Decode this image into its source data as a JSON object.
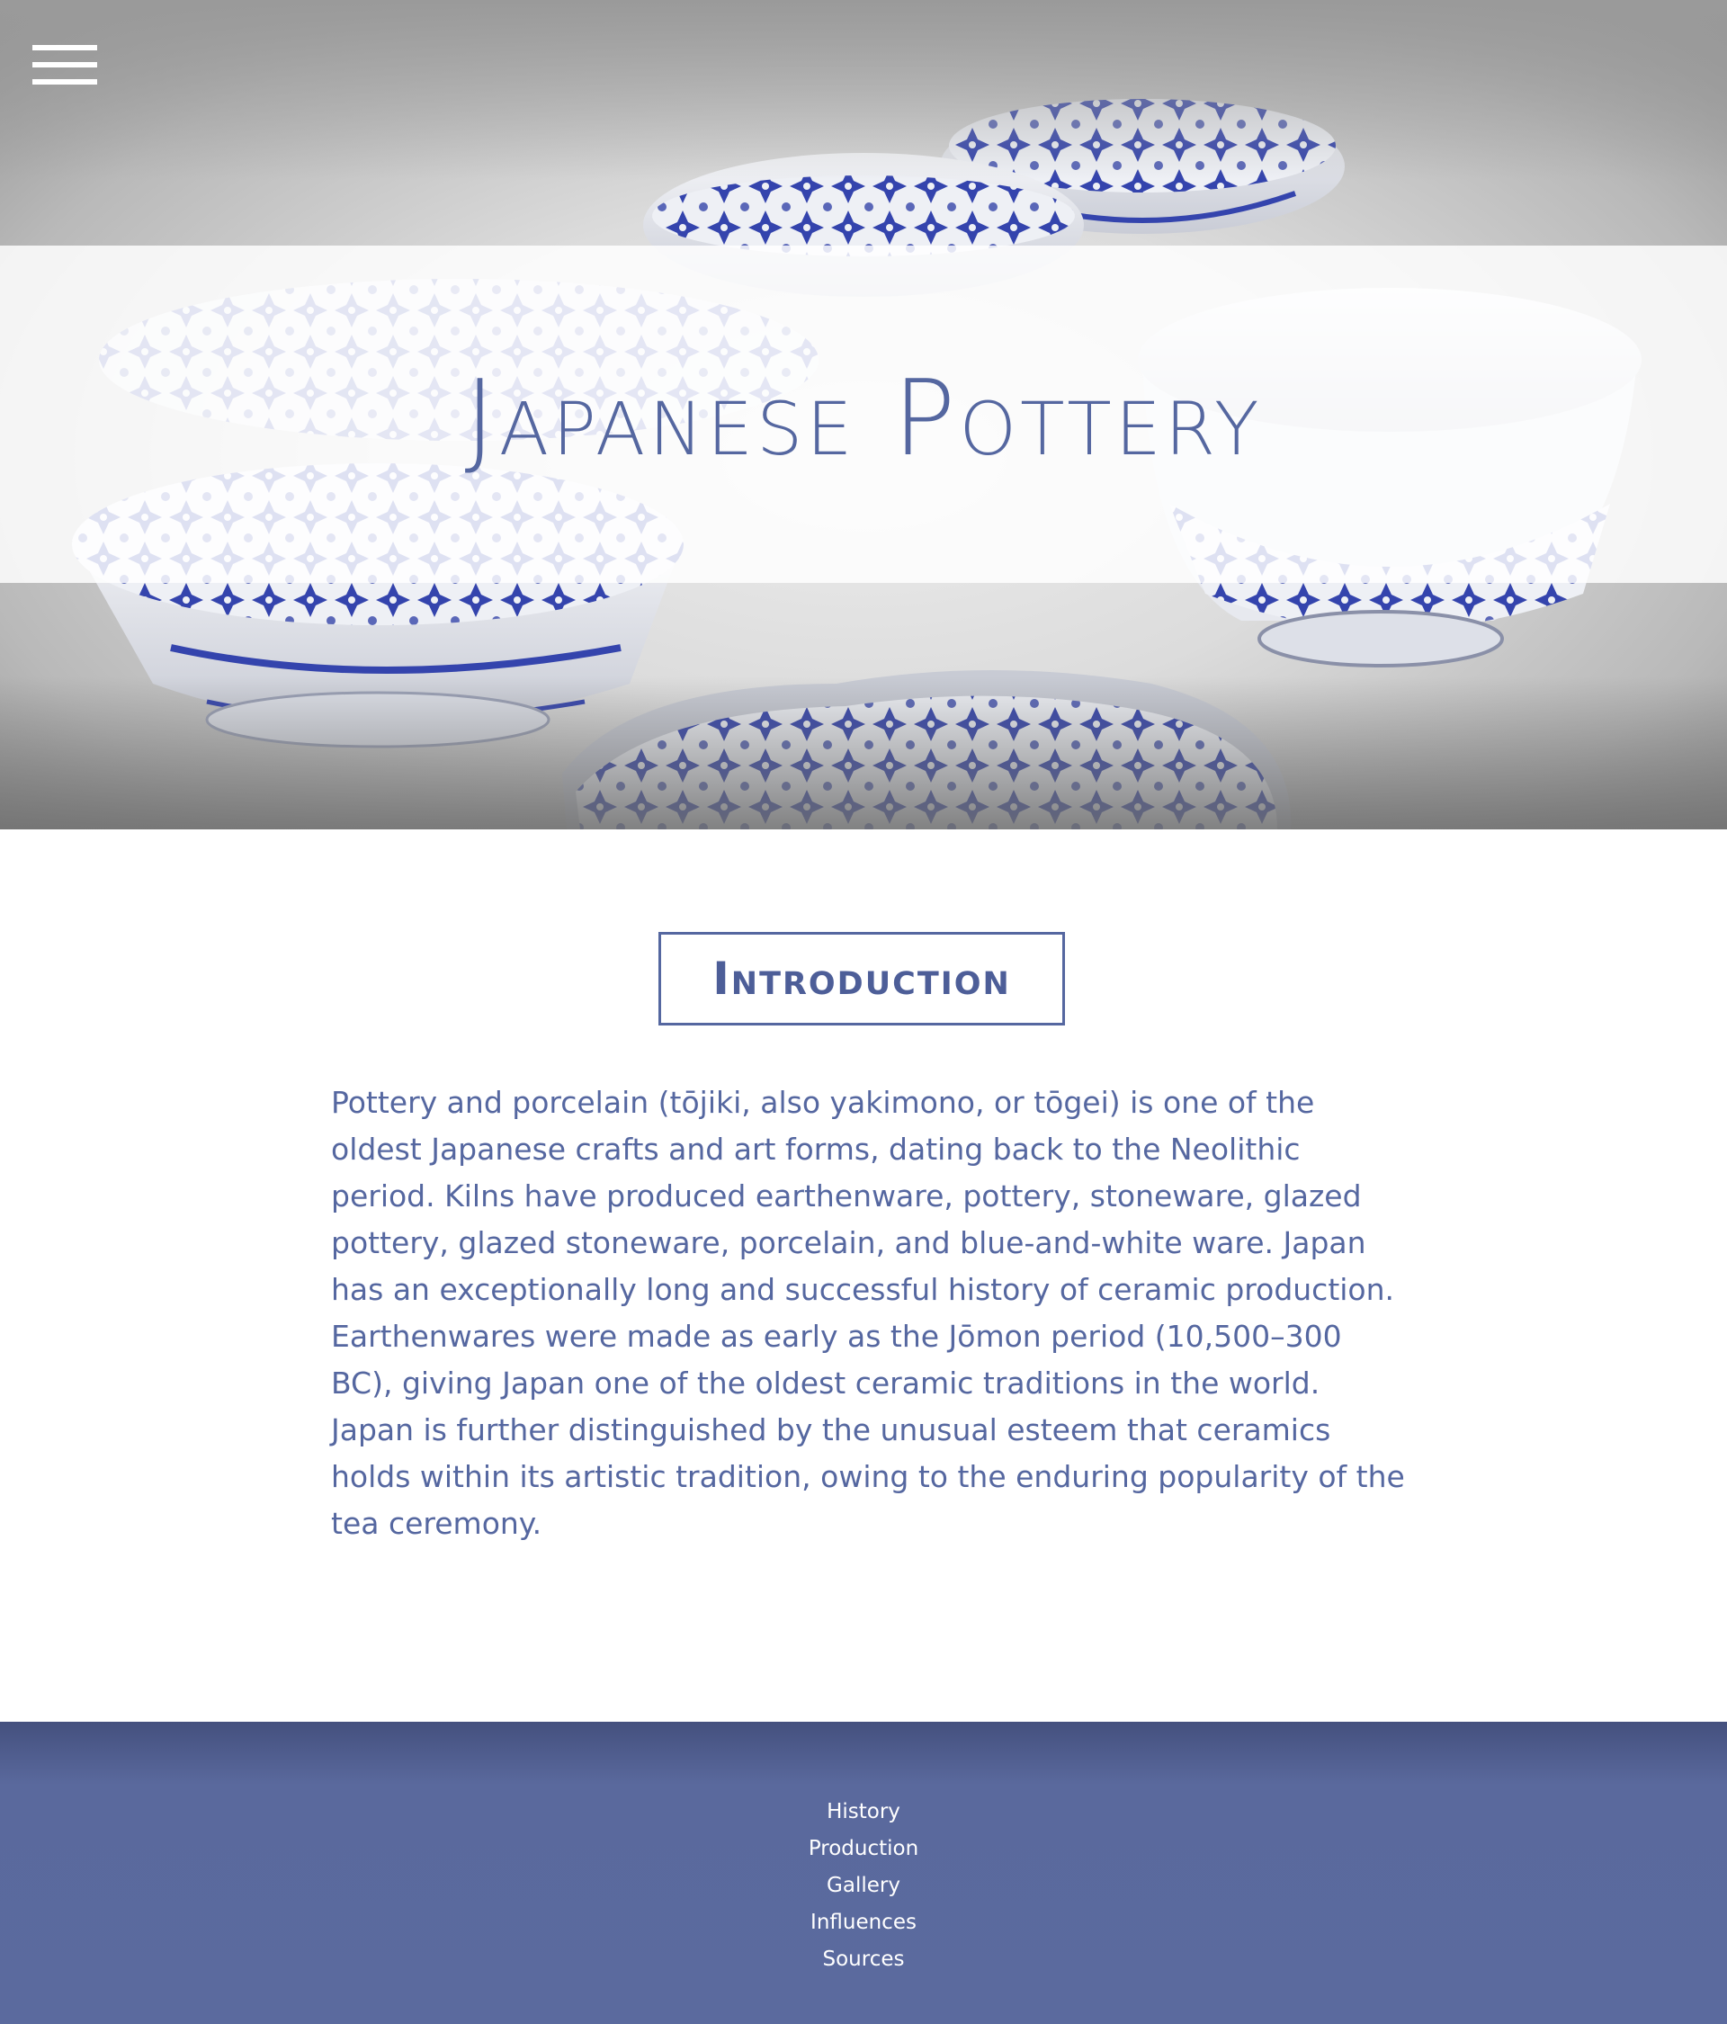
{
  "header": {
    "menu_icon": "hamburger-menu-icon",
    "title": "Japanese Pottery",
    "hero_image": "blue-and-white porcelain bowls"
  },
  "intro": {
    "heading": "Introduction",
    "body": "Pottery and porcelain (tōjiki, also yakimono, or tōgei) is one of the oldest Japanese crafts and art forms, dating back to the Neolithic period. Kilns have produced earthenware, pottery, stoneware, glazed pottery, glazed stoneware, porcelain, and blue-and-white ware. Japan has an exceptionally long and successful history of ceramic production. Earthenwares were made as early as the Jōmon period (10,500–300 BC), giving Japan one of the oldest ceramic traditions in the world. Japan is further distinguished by the unusual esteem that ceramics holds within its artistic tradition, owing to the enduring popularity of the tea ceremony."
  },
  "footer": {
    "nav": [
      "History",
      "Production",
      "Gallery",
      "Influences",
      "Sources"
    ]
  },
  "colors": {
    "accent": "#5567a0",
    "footer_bg": "#5b6a9e",
    "porcelain_blue": "#2f3fa8"
  }
}
